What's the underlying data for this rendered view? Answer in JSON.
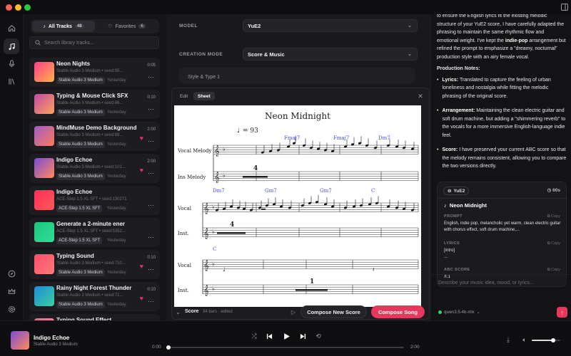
{
  "library": {
    "tabs": [
      {
        "label": "All Tracks",
        "count": "48"
      },
      {
        "label": "Favorites",
        "count": "6"
      }
    ],
    "search_placeholder": "Search library tracks...",
    "tracks": [
      {
        "title": "Neon Nights",
        "meta": "Stable Audio 3 Medium • seed:95...",
        "badge": "Stable Audio 3 Medium",
        "day": "Yesterday",
        "duration": "0:05",
        "fav": false,
        "grad": [
          "#ff3d8b",
          "#ffb347"
        ]
      },
      {
        "title": "Typing & Mouse Click SFX",
        "meta": "Stable Audio 3 Medium • seed:86...",
        "badge": "Stable Audio 3 Medium",
        "day": "Yesterday",
        "duration": "0:10",
        "fav": false,
        "grad": [
          "#c04ba6",
          "#ffa15a"
        ]
      },
      {
        "title": "MindMuse Demo Background",
        "meta": "Stable Audio 3 Medium • seed:89...",
        "badge": "Stable Audio 3 Medium",
        "day": "Yesterday",
        "duration": "2:00",
        "fav": true,
        "grad": [
          "#9e5cc8",
          "#ff7a5a"
        ]
      },
      {
        "title": "Indigo Echoe",
        "meta": "Stable Audio 3 Medium • seed:101...",
        "badge": "Stable Audio 3 Medium",
        "day": "Yesterday",
        "duration": "2:00",
        "fav": true,
        "grad": [
          "#7c4bd8",
          "#ff8a5a"
        ]
      },
      {
        "title": "Indigo Echoe",
        "meta": "ACE-Step 1.5 XL SFT • seed:130271",
        "badge": "ACE-Step 1.5 XL SFT",
        "day": "Yesterday",
        "duration": "",
        "fav": false,
        "grad": [
          "#ff2d5a",
          "#ff5a5a"
        ]
      },
      {
        "title": "Generate a 2-minute ener",
        "meta": "ACE-Step 1.5 XL SFT • seed:5352...",
        "badge": "ACE-Step 1.5 XL SFT",
        "day": "Yesterday",
        "duration": "",
        "fav": false,
        "grad": [
          "#1ec77a",
          "#2fdc9a"
        ]
      },
      {
        "title": "Typing Sound",
        "meta": "Stable Audio 3 Medium • seed:710...",
        "badge": "Stable Audio 3 Medium",
        "day": "Yesterday",
        "duration": "0:10",
        "fav": true,
        "grad": [
          "#ff4d6d",
          "#ff7a7a"
        ]
      },
      {
        "title": "Rainy Night Forest Thunder",
        "meta": "Stable Audio 3 Medium • seed:71...",
        "badge": "Stable Audio 3 Medium",
        "day": "Yesterday",
        "duration": "0:10",
        "fav": true,
        "grad": [
          "#1f8ad8",
          "#39d1a0"
        ]
      },
      {
        "title": "Typing Sound Effect",
        "meta": "",
        "badge": "",
        "day": "",
        "duration": "",
        "fav": false,
        "grad": [
          "#ff5a8a",
          "#ffa0a0"
        ]
      }
    ]
  },
  "config": {
    "model_label": "MODEL",
    "model_value": "YuE2",
    "mode_label": "CREATION MODE",
    "mode_value": "Score & Music",
    "style_label": "Style & Type  1"
  },
  "sheet": {
    "tabs": [
      "Edit",
      "Sheet"
    ],
    "title": "Neon Midnight",
    "tempo": "= 93",
    "parts": [
      "Vocal Melody",
      "Ins Melody",
      "Vocal",
      "Inst.",
      "Vocal",
      "Inst."
    ],
    "chords_1": [
      "Fmaj7",
      "Fmaj7",
      "Dm7"
    ],
    "chords_2": [
      "Dm7",
      "Gm7",
      "Gm7",
      "C"
    ],
    "chords_3": [
      "C"
    ],
    "rest_numbers": [
      "4",
      "4",
      "1"
    ],
    "footer_label": "Score",
    "footer_meta": "34 bars · edited",
    "compose_new": "Compose New Score",
    "compose_song": "Compose Song"
  },
  "assistant": {
    "intro_1": "to ensure the English lyrics fit the existing melodic structure of your YuE2 score, I have carefully adapted the phrasing to maintain the same rhythmic flow and emotional weight. I've kept the ",
    "intro_bold": "indie-pop",
    "intro_2": " arrangement but refined the prompt to emphasize a \"dreamy, nocturnal\" production style with an airy female vocal.",
    "notes_title": "Production Notes:",
    "notes": [
      {
        "label": "Lyrics:",
        "text": " Translated to capture the feeling of urban loneliness and nostalgia while fitting the melodic phrasing of the original score."
      },
      {
        "label": "Arrangement:",
        "text": " Maintaining the clean electric guitar and soft drum machine, but adding a \"shimmering reverb\" to the vocals for a more immersive English-language indie feel."
      },
      {
        "label": "Score:",
        "text": " I have preserved your current ABC score so that the melody remains consistent, allowing you to compare the two versions directly."
      }
    ],
    "card": {
      "model": "YuE2",
      "duration": "60s",
      "title": "Neon Midnight",
      "prompt_label": "PROMPT",
      "copy": "Copy",
      "prompt": "English, indie pop, melancholic yet warm, clean electric guitar with chorus effect, soft drum machine,...",
      "lyrics_label": "LYRICS",
      "lyrics": "[intro]",
      "lyrics_2": "...",
      "abc_label": "ABC SCORE",
      "abc": "X:1"
    },
    "input_placeholder": "Describe your music idea, mood, or lyrics...",
    "model_chip": "qwen3.5-4b-mlx"
  },
  "player": {
    "title": "Indigo Echoe",
    "subtitle": "Stable Audio 3 Medium",
    "time_current": "0:00",
    "time_total": "2:00",
    "progress": 0.0,
    "volume": 0.75
  }
}
